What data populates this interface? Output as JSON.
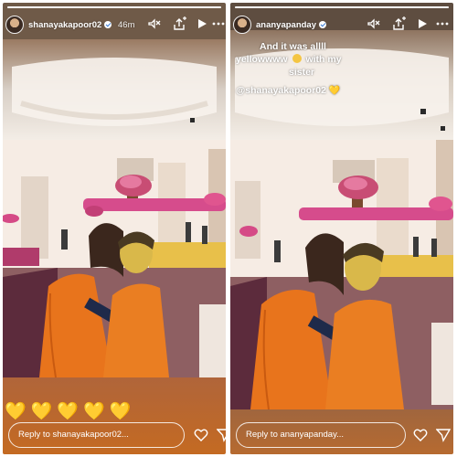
{
  "left_story": {
    "username": "shanayakapoor02",
    "timestamp": "46m",
    "reply_placeholder": "Reply to shanayakapoor02...",
    "sticker_hearts": [
      "💛",
      "💛",
      "💛",
      "💛",
      "💛"
    ],
    "progress": 1.0,
    "icons": [
      "mute-icon",
      "share-tag-icon",
      "play-icon",
      "more-icon",
      "heart-icon",
      "send-icon"
    ]
  },
  "right_story": {
    "username": "ananyapanday",
    "caption_line1": "And it was allll",
    "caption_line2a": "yellowwww",
    "caption_line2b": "with my",
    "caption_line3": "sister",
    "caption_mention": "@shanayakapoor02",
    "reply_placeholder": "Reply to ananyapanday...",
    "progress": 1.0,
    "icons": [
      "mute-icon",
      "share-tag-icon",
      "play-icon",
      "more-icon",
      "heart-icon",
      "send-icon"
    ]
  },
  "colors": {
    "wall": "#f6ece4",
    "orange_outfit": "#e8741c",
    "floor": "#8e5f62",
    "footer_left": "#c26a26",
    "footer_right": "#b66a30",
    "flowers": "#d64c8c"
  }
}
